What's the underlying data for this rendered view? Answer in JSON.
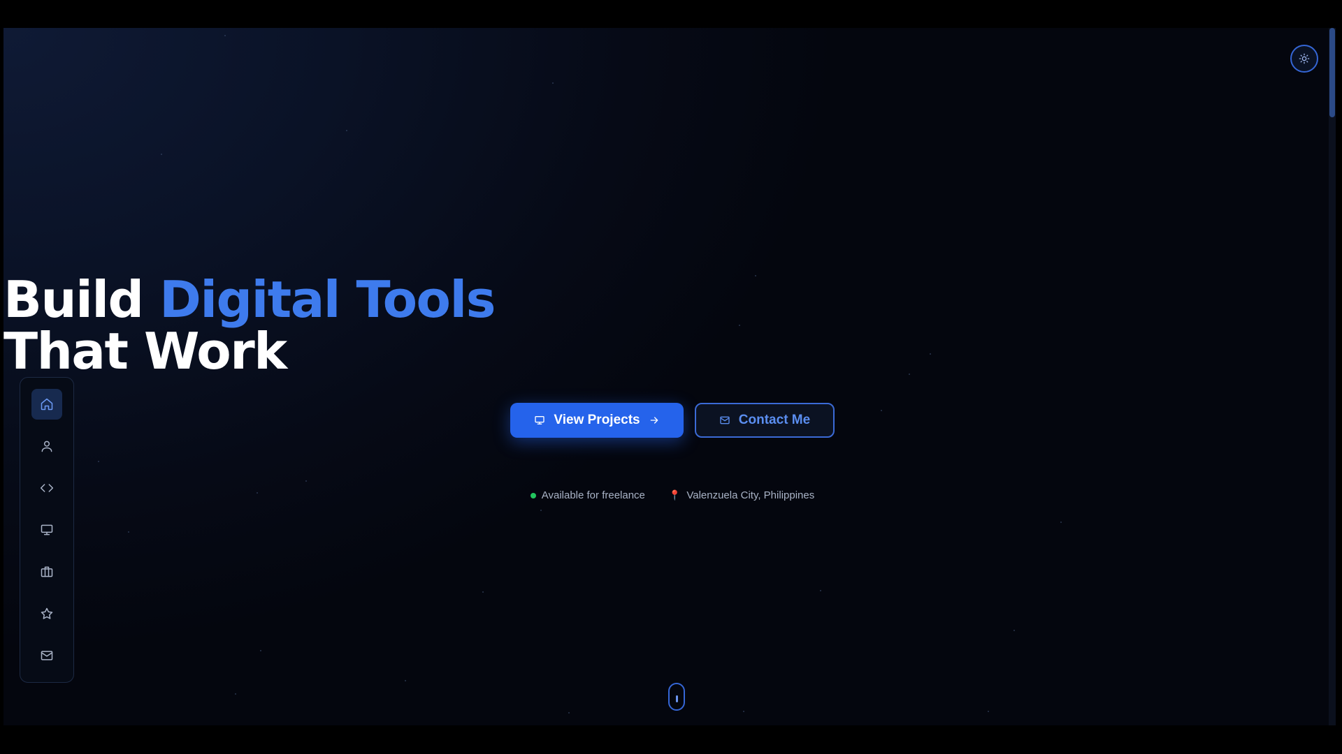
{
  "hero": {
    "headline_part1": "Build ",
    "headline_accent": "Digital Tools",
    "headline_line2": "That Work"
  },
  "cta": {
    "primary_label": "View Projects",
    "secondary_label": "Contact Me"
  },
  "meta": {
    "availability": "Available for freelance",
    "location": "Valenzuela City, Philippines"
  },
  "sidenav": {
    "items": [
      {
        "icon": "home-icon",
        "active": true
      },
      {
        "icon": "user-icon",
        "active": false
      },
      {
        "icon": "code-icon",
        "active": false
      },
      {
        "icon": "monitor-icon",
        "active": false
      },
      {
        "icon": "briefcase-icon",
        "active": false
      },
      {
        "icon": "star-icon",
        "active": false
      },
      {
        "icon": "mail-icon",
        "active": false
      }
    ]
  },
  "colors": {
    "accent": "#3e7bed",
    "primary_button": "#2563eb",
    "available_dot": "#22c55e",
    "location_pin": "#ef4444"
  }
}
